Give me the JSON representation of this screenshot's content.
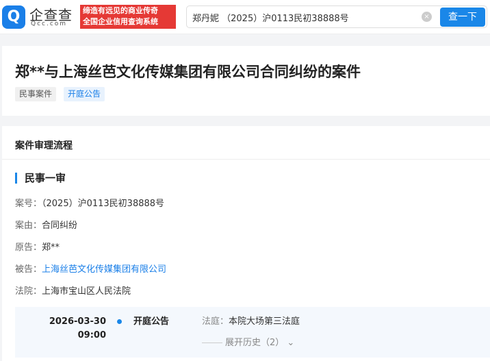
{
  "header": {
    "logo_text": "企查查",
    "logo_sub": "Qcc.com",
    "slogan_line1": "缔造有远见的商业传奇",
    "slogan_line2": "全国企业信用查询系统",
    "search_value": "郑丹妮 （2025）沪0113民初38888号",
    "search_button": "查一下"
  },
  "case": {
    "title": "郑**与上海丝芭文化传媒集团有限公司合同纠纷的案件",
    "tags": [
      "民事案件",
      "开庭公告"
    ]
  },
  "process": {
    "section_title": "案件审理流程",
    "stage": "民事一审",
    "fields": [
      {
        "label": "案号：",
        "value": "（2025）沪0113民初38888号"
      },
      {
        "label": "案由：",
        "value": "合同纠纷"
      },
      {
        "label": "原告：",
        "value": "郑**"
      },
      {
        "label": "被告：",
        "value": "上海丝芭文化传媒集团有限公司"
      },
      {
        "label": "法院：",
        "value": "上海市宝山区人民法院"
      }
    ],
    "timeline": {
      "date": "2026-03-30",
      "time": "09:00",
      "event": "开庭公告",
      "court_label": "法庭：",
      "court_value": "本院大场第三法庭",
      "expand": "展开历史（2）"
    }
  },
  "colors": {
    "accent": "#1a87e8",
    "slogan": "#e53935"
  }
}
